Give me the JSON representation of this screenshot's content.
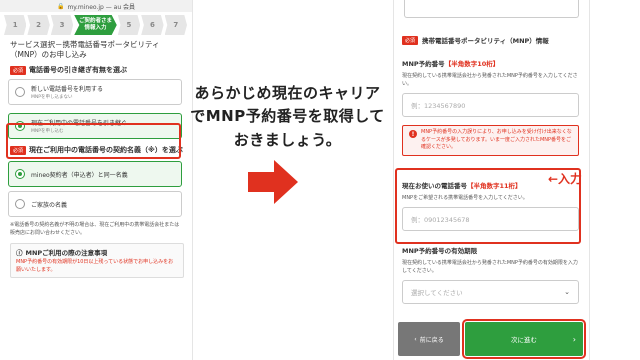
{
  "left": {
    "url": "my.mineo.jp — au 会員",
    "steps": [
      "1",
      "2",
      "3"
    ],
    "active_step_line1": "ご契約者さま",
    "active_step_line2": "情報入力",
    "steps_after": [
      "5",
      "6",
      "7"
    ],
    "section_title": "サービス選択－携帯電話番号ポータビリティ（MNP）のお申し込み",
    "req_badge": "必須",
    "q1_label": "電話番号の引き継ぎ有無を選ぶ",
    "opt1_main": "新しい電話番号を利用する",
    "opt1_sub": "MNPを申し込まない",
    "opt2_main": "現在ご利用中の電話番号を引き継ぐ",
    "opt2_sub": "MNPを申し込む",
    "q2_label": "現在ご利用中の電話番号の契約名義（※）を選ぶ",
    "opt3_main": "mineo契約者（申込者）と同一名義",
    "opt4_main": "ご家族の名義",
    "note": "※電話番号の契約名義が不明の場合は、現在ご利用中の携帯電話会社または販売店にお問い合わせください。",
    "caution_title": "MNPご利用の際の注意事項",
    "caution_text": "MNP予約番号の有効期限が10日以上残っている状態でお申し込みをお願いいたします。"
  },
  "center": {
    "line1": "あらかじめ現在のキャリア",
    "line2": "でMNP予約番号を取得して",
    "line3": "おきましょう。"
  },
  "right": {
    "req_badge": "必須",
    "head_title": "携帯電話番号ポータビリティ（MNP）情報",
    "mnp_label": "MNP予約番号",
    "mnp_hint": "【半角数字10桁】",
    "mnp_help": "現在契約している携帯電話会社から発番されたMNP予約番号を入力してください。",
    "mnp_placeholder": "例：1234567890",
    "warn_text": "MNP予約番号の入力誤りにより、お申し込みを受け付け出来なくなるケースが多発しております。いま一度ご入力されたMNP番号をご確認ください。",
    "tel_label": "現在お使いの電話番号",
    "tel_hint": "【半角数字11桁】",
    "tel_help": "MNPをご希望される携帯電話番号を入力してください。",
    "tel_placeholder": "例：09012345678",
    "expiry_label": "MNP予約番号の有効期限",
    "expiry_help": "現在契約している携帯電話会社から発番されたMNP予約番号の有効期限を入力してください。",
    "expiry_placeholder": "選択してください",
    "back_label": "前に戻る",
    "next_label": "次に進む",
    "callout": "←入力"
  },
  "colors": {
    "accent_green": "#2e9e3e",
    "alert_red": "#e0311f"
  }
}
